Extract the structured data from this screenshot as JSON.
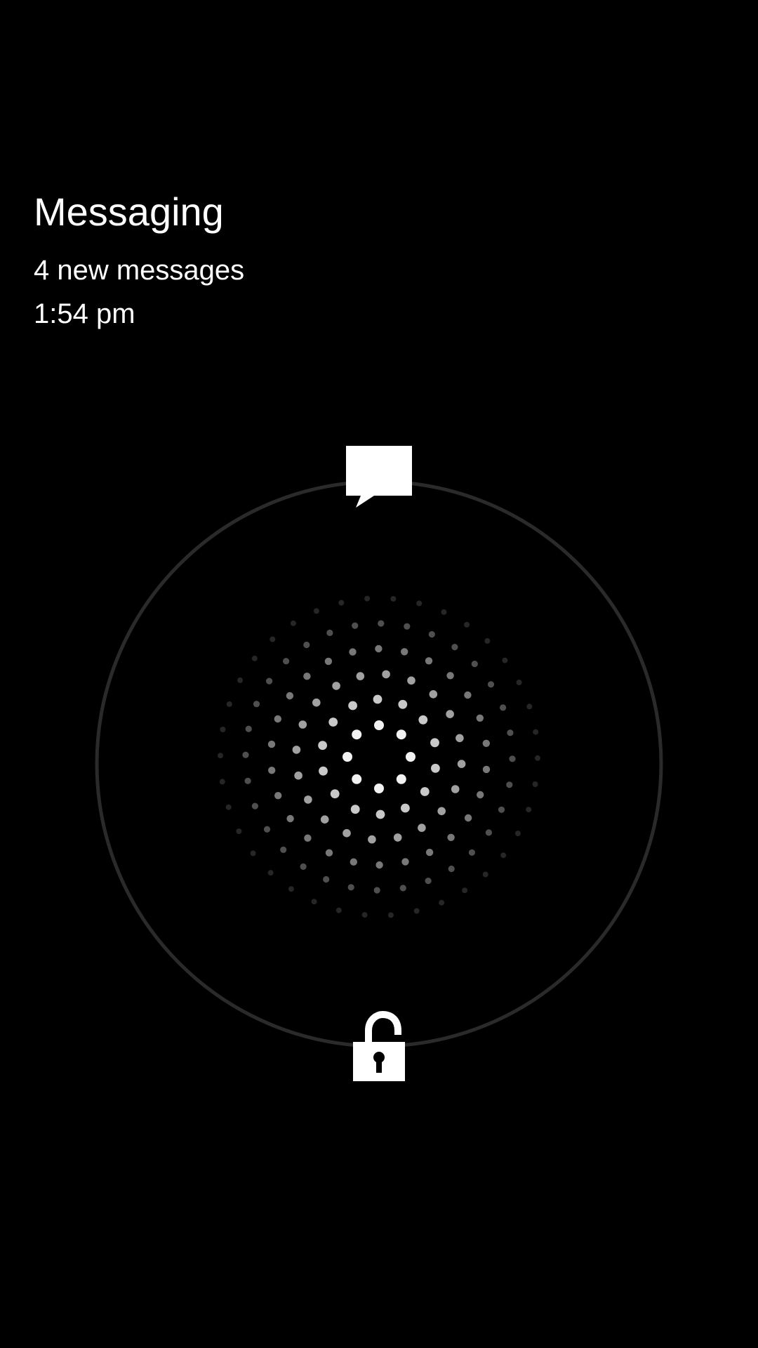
{
  "notification": {
    "app_name": "Messaging",
    "summary": "4 new messages",
    "time": "1:54 pm"
  },
  "lock_ring": {
    "top_target_icon": "message-icon",
    "bottom_target_icon": "unlock-icon",
    "center_handle_icon": "dot-grid-handle-icon"
  },
  "colors": {
    "background": "#000000",
    "foreground": "#ffffff",
    "ring": "#2a2a2a"
  }
}
